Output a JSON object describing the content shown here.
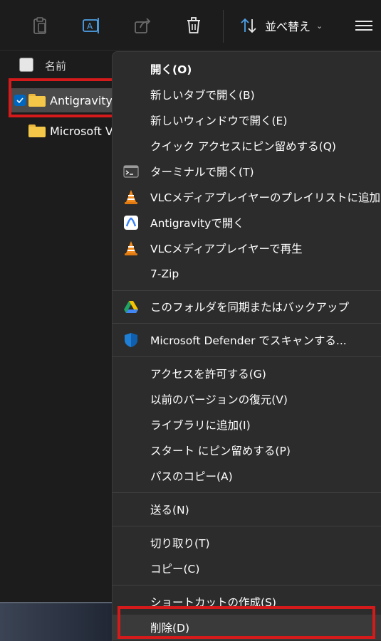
{
  "toolbar": {
    "icons": [
      "paste-icon",
      "rename-icon",
      "share-icon",
      "delete-icon"
    ],
    "sort_label": "並べ替え",
    "sort_icon": "sort-arrows-icon",
    "chevron": "⌄",
    "menu_icon": "hamburger-icon"
  },
  "file_list": {
    "header_name": "名前",
    "rows": [
      {
        "name": "Antigravity",
        "selected": true
      },
      {
        "name": "Microsoft V",
        "selected": false
      }
    ]
  },
  "context_menu": {
    "items": [
      {
        "label": "開く(O)",
        "icon": "",
        "bold": true
      },
      {
        "label": "新しいタブで開く(B)",
        "icon": ""
      },
      {
        "label": "新しいウィンドウで開く(E)",
        "icon": ""
      },
      {
        "label": "クイック アクセスにピン留めする(Q)",
        "icon": ""
      },
      {
        "label": "ターミナルで開く(T)",
        "icon": "terminal-icon"
      },
      {
        "label": "VLCメディアプレイヤーのプレイリストに追加",
        "icon": "vlc-icon"
      },
      {
        "label": "Antigravityで開く",
        "icon": "antigravity-icon"
      },
      {
        "label": "VLCメディアプレイヤーで再生",
        "icon": "vlc-icon"
      },
      {
        "label": "7-Zip",
        "icon": ""
      },
      {
        "label": "このフォルダを同期またはバックアップ",
        "icon": "google-drive-icon"
      },
      {
        "label": "Microsoft Defender でスキャンする...",
        "icon": "defender-shield-icon"
      },
      {
        "label": "アクセスを許可する(G)",
        "icon": ""
      },
      {
        "label": "以前のバージョンの復元(V)",
        "icon": ""
      },
      {
        "label": "ライブラリに追加(I)",
        "icon": ""
      },
      {
        "label": "スタート にピン留めする(P)",
        "icon": ""
      },
      {
        "label": "パスのコピー(A)",
        "icon": ""
      },
      {
        "label": "送る(N)",
        "icon": ""
      },
      {
        "label": "切り取り(T)",
        "icon": ""
      },
      {
        "label": "コピー(C)",
        "icon": ""
      },
      {
        "label": "ショートカットの作成(S)",
        "icon": ""
      },
      {
        "label": "削除(D)",
        "icon": ""
      }
    ]
  },
  "colors": {
    "background": "#1c1c1c",
    "menu_bg": "#2c2c2c",
    "accent": "#0067c0",
    "highlight_red": "#d41a1a",
    "folder": "#f5c748"
  }
}
